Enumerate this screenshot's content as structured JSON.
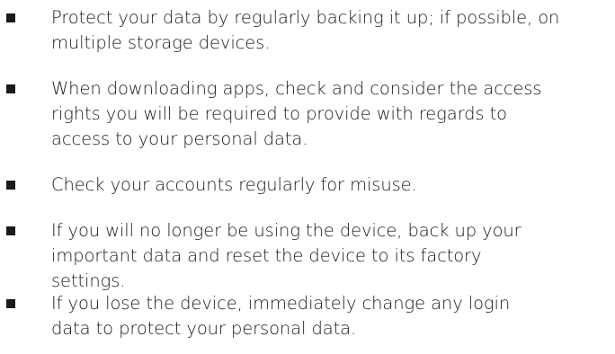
{
  "bullets": [
    {
      "lines": [
        "Protect your data by regularly backing it up; if possible, on",
        "multiple storage devices."
      ]
    },
    {
      "lines": [
        "When downloading apps, check and consider the access",
        "rights you will be required to provide with regards to",
        "access to your personal data."
      ]
    },
    {
      "lines": [
        "Check your accounts regularly for misuse."
      ]
    },
    {
      "lines": [
        "If you will no longer be using the device, back up your",
        "important data and reset the device to its factory",
        "settings."
      ]
    },
    {
      "lines": [
        "If you lose the device, immediately change any login",
        "data to protect your personal data."
      ]
    }
  ]
}
